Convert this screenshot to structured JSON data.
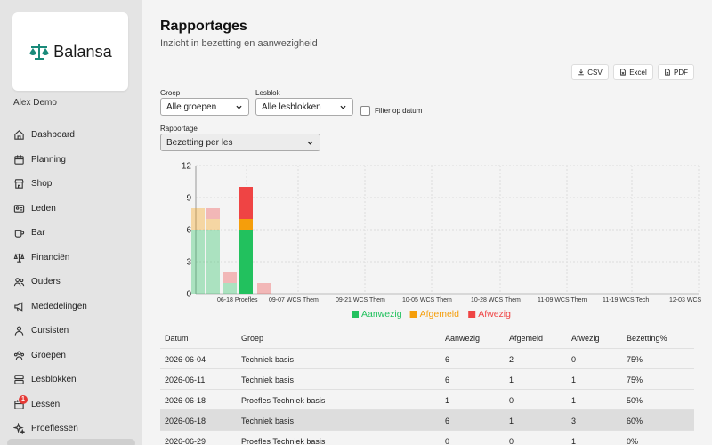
{
  "brand": {
    "name": "Balansa",
    "color": "#1a8a7a"
  },
  "user": {
    "name": "Alex Demo"
  },
  "nav": [
    {
      "label": "Dashboard",
      "icon": "home-icon"
    },
    {
      "label": "Planning",
      "icon": "calendar-icon"
    },
    {
      "label": "Shop",
      "icon": "shop-icon"
    },
    {
      "label": "Leden",
      "icon": "id-card-icon"
    },
    {
      "label": "Bar",
      "icon": "mug-icon"
    },
    {
      "label": "Financiën",
      "icon": "scale-icon"
    },
    {
      "label": "Ouders",
      "icon": "users-icon"
    },
    {
      "label": "Mededelingen",
      "icon": "megaphone-icon"
    },
    {
      "label": "Cursisten",
      "icon": "user-icon"
    },
    {
      "label": "Groepen",
      "icon": "group-icon"
    },
    {
      "label": "Lesblokken",
      "icon": "layers-icon"
    },
    {
      "label": "Lessen",
      "icon": "calendar-icon",
      "badge": "1"
    },
    {
      "label": "Proeflessen",
      "icon": "sparkle-icon"
    }
  ],
  "page": {
    "title": "Rapportages",
    "subtitle": "Inzicht in bezetting en aanwezigheid"
  },
  "exports": {
    "csv": "CSV",
    "excel": "Excel",
    "pdf": "PDF"
  },
  "filters": {
    "groep_label": "Groep",
    "groep_value": "Alle groepen",
    "lesblok_label": "Lesblok",
    "lesblok_value": "Alle lesblokken",
    "datum_filter_label": "Filter op datum",
    "datum_filter_checked": false,
    "rapportage_label": "Rapportage",
    "rapportage_value": "Bezetting per les"
  },
  "chart_data": {
    "type": "bar",
    "stacked": true,
    "title": "",
    "xlabel": "",
    "ylabel": "",
    "ylim": [
      0,
      12
    ],
    "yticks": [
      0,
      3,
      6,
      9,
      12
    ],
    "grid": true,
    "legend_position": "bottom",
    "x_tick_labels": [
      "06-18 Proefles",
      "09-07 WCS Them",
      "09-21 WCS Them",
      "10-05 WCS Them",
      "10-28 WCS Them",
      "11-09 WCS Them",
      "11-19 WCS Tech",
      "12-03 WCS Tech"
    ],
    "categories": [
      "2026-06-04",
      "2026-06-11",
      "2026-06-18",
      "2026-06-18",
      "2026-06-29"
    ],
    "series": [
      {
        "name": "Aanwezig",
        "color": "#22c15e",
        "values": [
          6,
          6,
          1,
          6,
          0
        ]
      },
      {
        "name": "Afgemeld",
        "color": "#f59e0b",
        "values": [
          2,
          1,
          0,
          1,
          0
        ]
      },
      {
        "name": "Afwezig",
        "color": "#ef4444",
        "values": [
          0,
          1,
          1,
          3,
          1
        ]
      }
    ],
    "highlighted_index": 3
  },
  "table": {
    "headers": [
      "Datum",
      "Groep",
      "Aanwezig",
      "Afgemeld",
      "Afwezig",
      "Bezetting%"
    ],
    "rows": [
      [
        "2026-06-04",
        "Techniek basis",
        "6",
        "2",
        "0",
        "75%"
      ],
      [
        "2026-06-11",
        "Techniek basis",
        "6",
        "1",
        "1",
        "75%"
      ],
      [
        "2026-06-18",
        "Proefles Techniek basis",
        "1",
        "0",
        "1",
        "50%"
      ],
      [
        "2026-06-18",
        "Techniek basis",
        "6",
        "1",
        "3",
        "60%"
      ],
      [
        "2026-06-29",
        "Proefles Techniek basis",
        "0",
        "0",
        "1",
        "0%"
      ]
    ],
    "highlighted_row": 3
  }
}
